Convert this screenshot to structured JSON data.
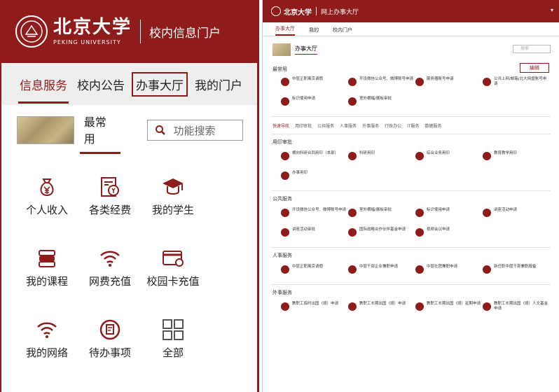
{
  "mobile": {
    "brand_cn": "北京大学",
    "brand_en": "PEKING UNIVERSITY",
    "portal_title": "校内信息门户",
    "tabs": [
      "信息服务",
      "校内公告",
      "办事大厅",
      "我的门户"
    ],
    "common_label": "最常用",
    "search_placeholder": "功能搜索",
    "apps": [
      {
        "label": "个人收入",
        "icon": "money-bag-icon"
      },
      {
        "label": "各类经费",
        "icon": "funds-document-icon"
      },
      {
        "label": "我的学生",
        "icon": "graduation-cap-icon"
      },
      {
        "label": "我的课程",
        "icon": "books-icon"
      },
      {
        "label": "网费充值",
        "icon": "wifi-icon"
      },
      {
        "label": "校园卡充值",
        "icon": "campus-card-icon"
      },
      {
        "label": "我的网络",
        "icon": "wifi-icon"
      },
      {
        "label": "待办事项",
        "icon": "todo-icon"
      },
      {
        "label": "全部",
        "icon": "grid-icon"
      }
    ],
    "colors": {
      "accent": "#8f1b1b"
    }
  },
  "desktop": {
    "brand_cn": "北京大学",
    "portal_title": "网上办事大厅",
    "nav": [
      "办事大厅",
      "我的",
      "校内门户"
    ],
    "hall_label": "办事大厅",
    "search_placeholder": "搜索",
    "most_used_title": "最常用",
    "edit_label": "编辑",
    "most_used": [
      "中层正职离京请假",
      "开设微信公众号、微博账号申请",
      "服务器账号申请",
      "公共上网/邮箱/北大网盘账号申请",
      "标识使用申请",
      "室外横幅/展板审批"
    ],
    "quick_nav": [
      "快速导航",
      "用印审批",
      "公共服务",
      "人事服务",
      "外事服务",
      "行政办公",
      "IT服务",
      "数据服务"
    ],
    "sections": [
      {
        "title": "用印审批",
        "items": [
          "横向科研合同用印（本部）",
          "科研用印",
          "综合业务用印",
          "教育教学用印",
          "办事用印"
        ]
      },
      {
        "title": "公共服务",
        "items": [
          "开设微信公众号、微博账号申请",
          "室外横幅/展板审批",
          "标识使用申请",
          "讲座活动申请",
          "讲座活动审批",
          "国际战略合作伙伴基金申请",
          "视频会议申请"
        ]
      },
      {
        "title": "人事服务",
        "items": [
          "中层正职离京请假",
          "中层干部企业兼职申请",
          "中层社团兼职申请",
          "新任职中层干部兼职报备"
        ]
      },
      {
        "title": "外事服务",
        "items": [
          "教职工临时出国（境）申请",
          "教职工长期出国（境）申请",
          "教职工长期出国（境）延期申请",
          "教职工长期出国（境）人文基金申请"
        ]
      }
    ]
  }
}
